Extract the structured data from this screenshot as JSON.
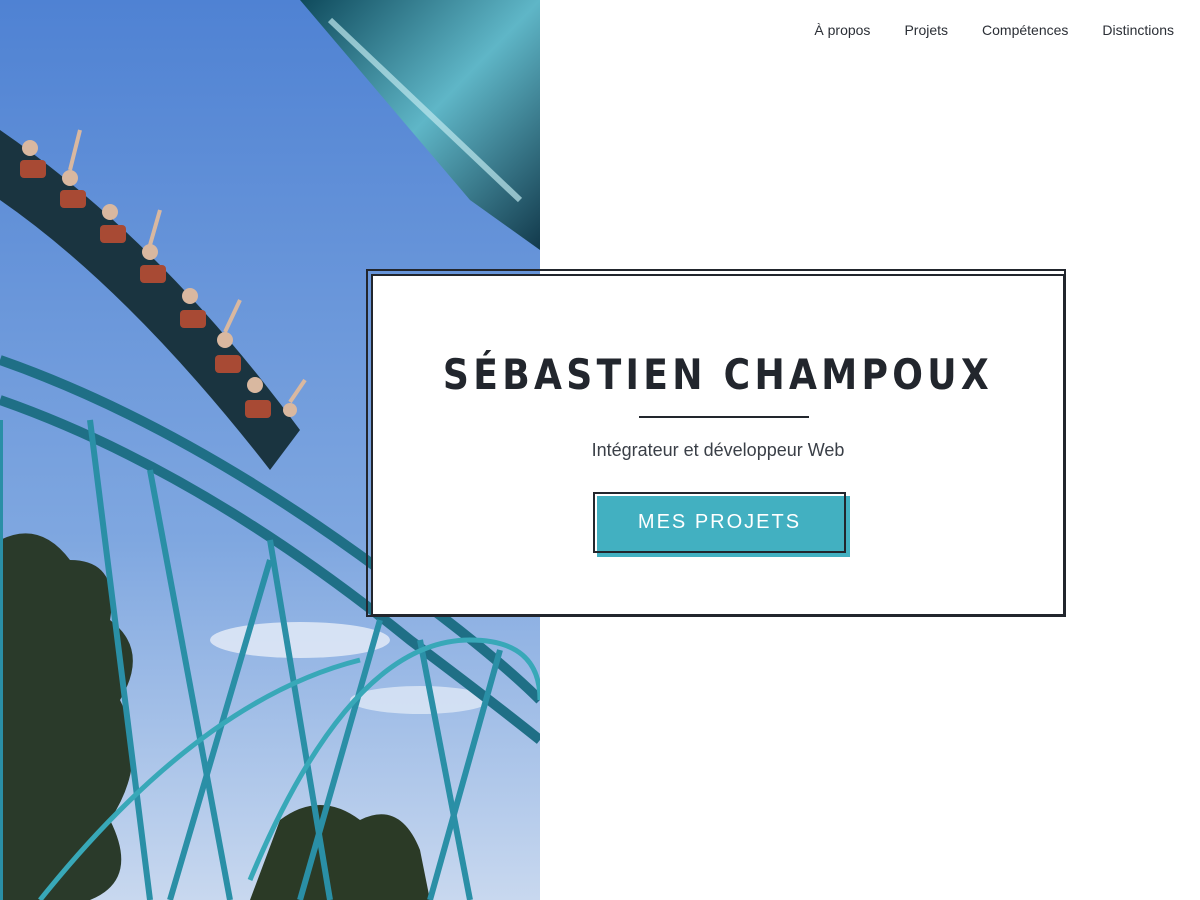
{
  "nav": {
    "items": [
      {
        "label": "À propos"
      },
      {
        "label": "Projets"
      },
      {
        "label": "Compétences"
      },
      {
        "label": "Distinctions"
      }
    ]
  },
  "hero": {
    "name": "SÉBASTIEN CHAMPOUX",
    "subtitle": "Intégrateur et développeur Web",
    "cta_label": "MES PROJETS"
  },
  "colors": {
    "accent": "#42b0c1",
    "text_dark": "#22262d",
    "sky": "#5c8fd8"
  },
  "icons": {
    "photo": "roller-coaster-photo"
  }
}
